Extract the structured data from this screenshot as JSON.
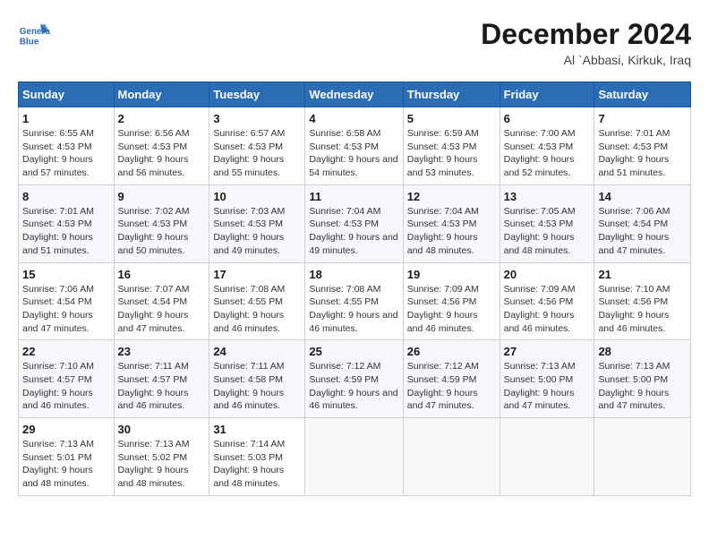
{
  "header": {
    "logo_line1": "General",
    "logo_line2": "Blue",
    "main_title": "December 2024",
    "subtitle": "Al `Abbasi, Kirkuk, Iraq"
  },
  "calendar": {
    "days_of_week": [
      "Sunday",
      "Monday",
      "Tuesday",
      "Wednesday",
      "Thursday",
      "Friday",
      "Saturday"
    ],
    "weeks": [
      [
        {
          "day": "1",
          "sunrise": "Sunrise: 6:55 AM",
          "sunset": "Sunset: 4:53 PM",
          "daylight": "Daylight: 9 hours and 57 minutes."
        },
        {
          "day": "2",
          "sunrise": "Sunrise: 6:56 AM",
          "sunset": "Sunset: 4:53 PM",
          "daylight": "Daylight: 9 hours and 56 minutes."
        },
        {
          "day": "3",
          "sunrise": "Sunrise: 6:57 AM",
          "sunset": "Sunset: 4:53 PM",
          "daylight": "Daylight: 9 hours and 55 minutes."
        },
        {
          "day": "4",
          "sunrise": "Sunrise: 6:58 AM",
          "sunset": "Sunset: 4:53 PM",
          "daylight": "Daylight: 9 hours and 54 minutes."
        },
        {
          "day": "5",
          "sunrise": "Sunrise: 6:59 AM",
          "sunset": "Sunset: 4:53 PM",
          "daylight": "Daylight: 9 hours and 53 minutes."
        },
        {
          "day": "6",
          "sunrise": "Sunrise: 7:00 AM",
          "sunset": "Sunset: 4:53 PM",
          "daylight": "Daylight: 9 hours and 52 minutes."
        },
        {
          "day": "7",
          "sunrise": "Sunrise: 7:01 AM",
          "sunset": "Sunset: 4:53 PM",
          "daylight": "Daylight: 9 hours and 51 minutes."
        }
      ],
      [
        {
          "day": "8",
          "sunrise": "Sunrise: 7:01 AM",
          "sunset": "Sunset: 4:53 PM",
          "daylight": "Daylight: 9 hours and 51 minutes."
        },
        {
          "day": "9",
          "sunrise": "Sunrise: 7:02 AM",
          "sunset": "Sunset: 4:53 PM",
          "daylight": "Daylight: 9 hours and 50 minutes."
        },
        {
          "day": "10",
          "sunrise": "Sunrise: 7:03 AM",
          "sunset": "Sunset: 4:53 PM",
          "daylight": "Daylight: 9 hours and 49 minutes."
        },
        {
          "day": "11",
          "sunrise": "Sunrise: 7:04 AM",
          "sunset": "Sunset: 4:53 PM",
          "daylight": "Daylight: 9 hours and 49 minutes."
        },
        {
          "day": "12",
          "sunrise": "Sunrise: 7:04 AM",
          "sunset": "Sunset: 4:53 PM",
          "daylight": "Daylight: 9 hours and 48 minutes."
        },
        {
          "day": "13",
          "sunrise": "Sunrise: 7:05 AM",
          "sunset": "Sunset: 4:53 PM",
          "daylight": "Daylight: 9 hours and 48 minutes."
        },
        {
          "day": "14",
          "sunrise": "Sunrise: 7:06 AM",
          "sunset": "Sunset: 4:54 PM",
          "daylight": "Daylight: 9 hours and 47 minutes."
        }
      ],
      [
        {
          "day": "15",
          "sunrise": "Sunrise: 7:06 AM",
          "sunset": "Sunset: 4:54 PM",
          "daylight": "Daylight: 9 hours and 47 minutes."
        },
        {
          "day": "16",
          "sunrise": "Sunrise: 7:07 AM",
          "sunset": "Sunset: 4:54 PM",
          "daylight": "Daylight: 9 hours and 47 minutes."
        },
        {
          "day": "17",
          "sunrise": "Sunrise: 7:08 AM",
          "sunset": "Sunset: 4:55 PM",
          "daylight": "Daylight: 9 hours and 46 minutes."
        },
        {
          "day": "18",
          "sunrise": "Sunrise: 7:08 AM",
          "sunset": "Sunset: 4:55 PM",
          "daylight": "Daylight: 9 hours and 46 minutes."
        },
        {
          "day": "19",
          "sunrise": "Sunrise: 7:09 AM",
          "sunset": "Sunset: 4:56 PM",
          "daylight": "Daylight: 9 hours and 46 minutes."
        },
        {
          "day": "20",
          "sunrise": "Sunrise: 7:09 AM",
          "sunset": "Sunset: 4:56 PM",
          "daylight": "Daylight: 9 hours and 46 minutes."
        },
        {
          "day": "21",
          "sunrise": "Sunrise: 7:10 AM",
          "sunset": "Sunset: 4:56 PM",
          "daylight": "Daylight: 9 hours and 46 minutes."
        }
      ],
      [
        {
          "day": "22",
          "sunrise": "Sunrise: 7:10 AM",
          "sunset": "Sunset: 4:57 PM",
          "daylight": "Daylight: 9 hours and 46 minutes."
        },
        {
          "day": "23",
          "sunrise": "Sunrise: 7:11 AM",
          "sunset": "Sunset: 4:57 PM",
          "daylight": "Daylight: 9 hours and 46 minutes."
        },
        {
          "day": "24",
          "sunrise": "Sunrise: 7:11 AM",
          "sunset": "Sunset: 4:58 PM",
          "daylight": "Daylight: 9 hours and 46 minutes."
        },
        {
          "day": "25",
          "sunrise": "Sunrise: 7:12 AM",
          "sunset": "Sunset: 4:59 PM",
          "daylight": "Daylight: 9 hours and 46 minutes."
        },
        {
          "day": "26",
          "sunrise": "Sunrise: 7:12 AM",
          "sunset": "Sunset: 4:59 PM",
          "daylight": "Daylight: 9 hours and 47 minutes."
        },
        {
          "day": "27",
          "sunrise": "Sunrise: 7:13 AM",
          "sunset": "Sunset: 5:00 PM",
          "daylight": "Daylight: 9 hours and 47 minutes."
        },
        {
          "day": "28",
          "sunrise": "Sunrise: 7:13 AM",
          "sunset": "Sunset: 5:00 PM",
          "daylight": "Daylight: 9 hours and 47 minutes."
        }
      ],
      [
        {
          "day": "29",
          "sunrise": "Sunrise: 7:13 AM",
          "sunset": "Sunset: 5:01 PM",
          "daylight": "Daylight: 9 hours and 48 minutes."
        },
        {
          "day": "30",
          "sunrise": "Sunrise: 7:13 AM",
          "sunset": "Sunset: 5:02 PM",
          "daylight": "Daylight: 9 hours and 48 minutes."
        },
        {
          "day": "31",
          "sunrise": "Sunrise: 7:14 AM",
          "sunset": "Sunset: 5:03 PM",
          "daylight": "Daylight: 9 hours and 48 minutes."
        },
        null,
        null,
        null,
        null
      ]
    ]
  }
}
